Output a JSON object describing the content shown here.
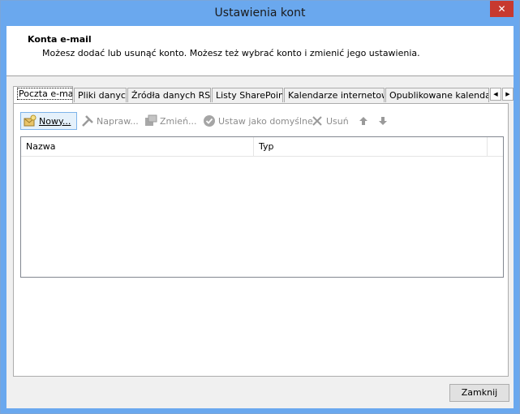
{
  "window": {
    "title": "Ustawienia kont",
    "close_glyph": "✕"
  },
  "header": {
    "title": "Konta e-mail",
    "description": "Możesz dodać lub usunąć konto. Możesz też wybrać konto i zmienić jego ustawienia."
  },
  "tabs": [
    {
      "label": "Poczta e-mail",
      "active": true
    },
    {
      "label": "Pliki danych",
      "active": false
    },
    {
      "label": "Źródła danych RSS",
      "active": false
    },
    {
      "label": "Listy SharePoint",
      "active": false
    },
    {
      "label": "Kalendarze internetowe",
      "active": false
    },
    {
      "label": "Opublikowane kalendarze",
      "active": false
    }
  ],
  "tab_scroll": {
    "left": "◀",
    "right": "▶"
  },
  "toolbar": {
    "new_label": "Nowy...",
    "repair_label": "Napraw...",
    "change_label": "Zmień...",
    "default_label": "Ustaw jako domyślne",
    "remove_label": "Usuń"
  },
  "icons": {
    "new": "new-account-icon",
    "repair": "repair-tools-icon",
    "change": "change-icon",
    "default": "checkmark-circle-icon",
    "remove": "x-icon",
    "up": "arrow-up-icon",
    "down": "arrow-down-icon"
  },
  "list": {
    "columns": [
      "Nazwa",
      "Typ"
    ]
  },
  "footer": {
    "close_label": "Zamknij"
  },
  "colors": {
    "titlebar": "#6aa8ee",
    "close": "#c7392f"
  }
}
